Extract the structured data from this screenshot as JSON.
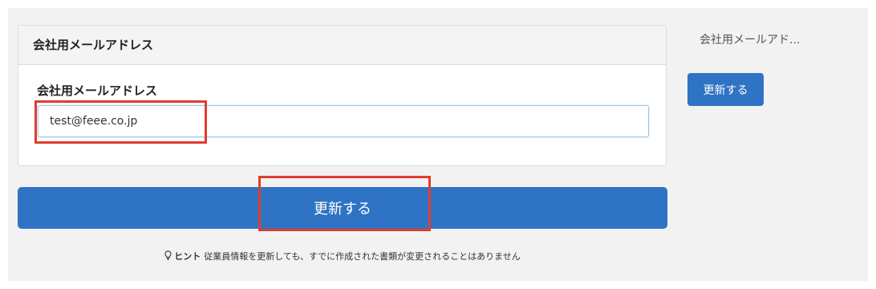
{
  "panel": {
    "header_title": "会社用メールアドレス",
    "field_label": "会社用メールアドレス",
    "email_value": "test@feee.co.jp"
  },
  "main_button_label": "更新する",
  "hint": {
    "label": "ヒント",
    "text": "従業員情報を更新しても、すでに作成された書類が変更されることはありません",
    "icon": "lightbulb-icon"
  },
  "sidebar": {
    "field_label": "会社用メールアド...",
    "button_label": "更新する"
  },
  "colors": {
    "primary": "#2f73c4",
    "highlight": "#e23c2f",
    "background": "#f2f2f2"
  }
}
